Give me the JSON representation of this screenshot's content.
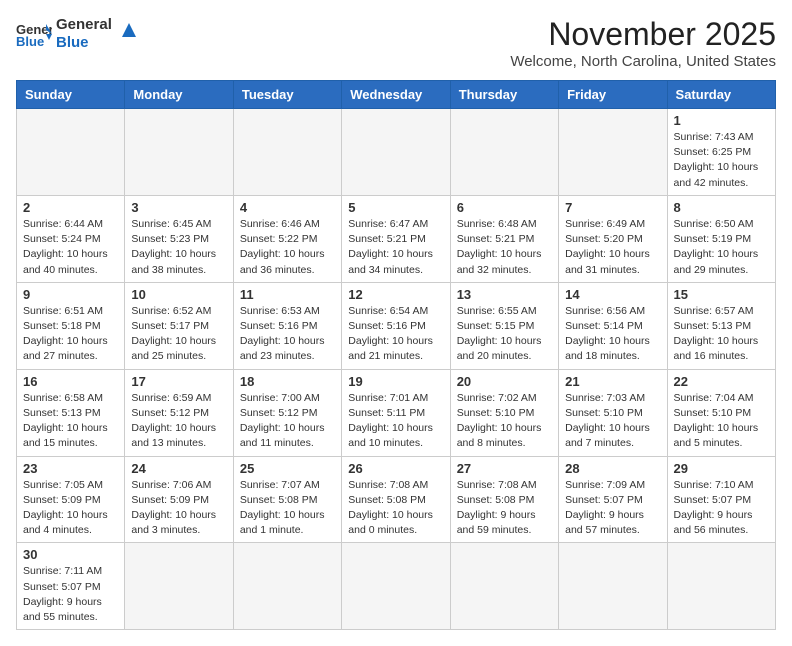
{
  "header": {
    "logo_general": "General",
    "logo_blue": "Blue",
    "month": "November 2025",
    "location": "Welcome, North Carolina, United States"
  },
  "weekdays": [
    "Sunday",
    "Monday",
    "Tuesday",
    "Wednesday",
    "Thursday",
    "Friday",
    "Saturday"
  ],
  "weeks": [
    [
      {
        "day": "",
        "info": ""
      },
      {
        "day": "",
        "info": ""
      },
      {
        "day": "",
        "info": ""
      },
      {
        "day": "",
        "info": ""
      },
      {
        "day": "",
        "info": ""
      },
      {
        "day": "",
        "info": ""
      },
      {
        "day": "1",
        "info": "Sunrise: 7:43 AM\nSunset: 6:25 PM\nDaylight: 10 hours\nand 42 minutes."
      }
    ],
    [
      {
        "day": "2",
        "info": "Sunrise: 6:44 AM\nSunset: 5:24 PM\nDaylight: 10 hours\nand 40 minutes."
      },
      {
        "day": "3",
        "info": "Sunrise: 6:45 AM\nSunset: 5:23 PM\nDaylight: 10 hours\nand 38 minutes."
      },
      {
        "day": "4",
        "info": "Sunrise: 6:46 AM\nSunset: 5:22 PM\nDaylight: 10 hours\nand 36 minutes."
      },
      {
        "day": "5",
        "info": "Sunrise: 6:47 AM\nSunset: 5:21 PM\nDaylight: 10 hours\nand 34 minutes."
      },
      {
        "day": "6",
        "info": "Sunrise: 6:48 AM\nSunset: 5:21 PM\nDaylight: 10 hours\nand 32 minutes."
      },
      {
        "day": "7",
        "info": "Sunrise: 6:49 AM\nSunset: 5:20 PM\nDaylight: 10 hours\nand 31 minutes."
      },
      {
        "day": "8",
        "info": "Sunrise: 6:50 AM\nSunset: 5:19 PM\nDaylight: 10 hours\nand 29 minutes."
      }
    ],
    [
      {
        "day": "9",
        "info": "Sunrise: 6:51 AM\nSunset: 5:18 PM\nDaylight: 10 hours\nand 27 minutes."
      },
      {
        "day": "10",
        "info": "Sunrise: 6:52 AM\nSunset: 5:17 PM\nDaylight: 10 hours\nand 25 minutes."
      },
      {
        "day": "11",
        "info": "Sunrise: 6:53 AM\nSunset: 5:16 PM\nDaylight: 10 hours\nand 23 minutes."
      },
      {
        "day": "12",
        "info": "Sunrise: 6:54 AM\nSunset: 5:16 PM\nDaylight: 10 hours\nand 21 minutes."
      },
      {
        "day": "13",
        "info": "Sunrise: 6:55 AM\nSunset: 5:15 PM\nDaylight: 10 hours\nand 20 minutes."
      },
      {
        "day": "14",
        "info": "Sunrise: 6:56 AM\nSunset: 5:14 PM\nDaylight: 10 hours\nand 18 minutes."
      },
      {
        "day": "15",
        "info": "Sunrise: 6:57 AM\nSunset: 5:13 PM\nDaylight: 10 hours\nand 16 minutes."
      }
    ],
    [
      {
        "day": "16",
        "info": "Sunrise: 6:58 AM\nSunset: 5:13 PM\nDaylight: 10 hours\nand 15 minutes."
      },
      {
        "day": "17",
        "info": "Sunrise: 6:59 AM\nSunset: 5:12 PM\nDaylight: 10 hours\nand 13 minutes."
      },
      {
        "day": "18",
        "info": "Sunrise: 7:00 AM\nSunset: 5:12 PM\nDaylight: 10 hours\nand 11 minutes."
      },
      {
        "day": "19",
        "info": "Sunrise: 7:01 AM\nSunset: 5:11 PM\nDaylight: 10 hours\nand 10 minutes."
      },
      {
        "day": "20",
        "info": "Sunrise: 7:02 AM\nSunset: 5:10 PM\nDaylight: 10 hours\nand 8 minutes."
      },
      {
        "day": "21",
        "info": "Sunrise: 7:03 AM\nSunset: 5:10 PM\nDaylight: 10 hours\nand 7 minutes."
      },
      {
        "day": "22",
        "info": "Sunrise: 7:04 AM\nSunset: 5:10 PM\nDaylight: 10 hours\nand 5 minutes."
      }
    ],
    [
      {
        "day": "23",
        "info": "Sunrise: 7:05 AM\nSunset: 5:09 PM\nDaylight: 10 hours\nand 4 minutes."
      },
      {
        "day": "24",
        "info": "Sunrise: 7:06 AM\nSunset: 5:09 PM\nDaylight: 10 hours\nand 3 minutes."
      },
      {
        "day": "25",
        "info": "Sunrise: 7:07 AM\nSunset: 5:08 PM\nDaylight: 10 hours\nand 1 minute."
      },
      {
        "day": "26",
        "info": "Sunrise: 7:08 AM\nSunset: 5:08 PM\nDaylight: 10 hours\nand 0 minutes."
      },
      {
        "day": "27",
        "info": "Sunrise: 7:08 AM\nSunset: 5:08 PM\nDaylight: 9 hours\nand 59 minutes."
      },
      {
        "day": "28",
        "info": "Sunrise: 7:09 AM\nSunset: 5:07 PM\nDaylight: 9 hours\nand 57 minutes."
      },
      {
        "day": "29",
        "info": "Sunrise: 7:10 AM\nSunset: 5:07 PM\nDaylight: 9 hours\nand 56 minutes."
      }
    ],
    [
      {
        "day": "30",
        "info": "Sunrise: 7:11 AM\nSunset: 5:07 PM\nDaylight: 9 hours\nand 55 minutes."
      },
      {
        "day": "",
        "info": ""
      },
      {
        "day": "",
        "info": ""
      },
      {
        "day": "",
        "info": ""
      },
      {
        "day": "",
        "info": ""
      },
      {
        "day": "",
        "info": ""
      },
      {
        "day": "",
        "info": ""
      }
    ]
  ]
}
